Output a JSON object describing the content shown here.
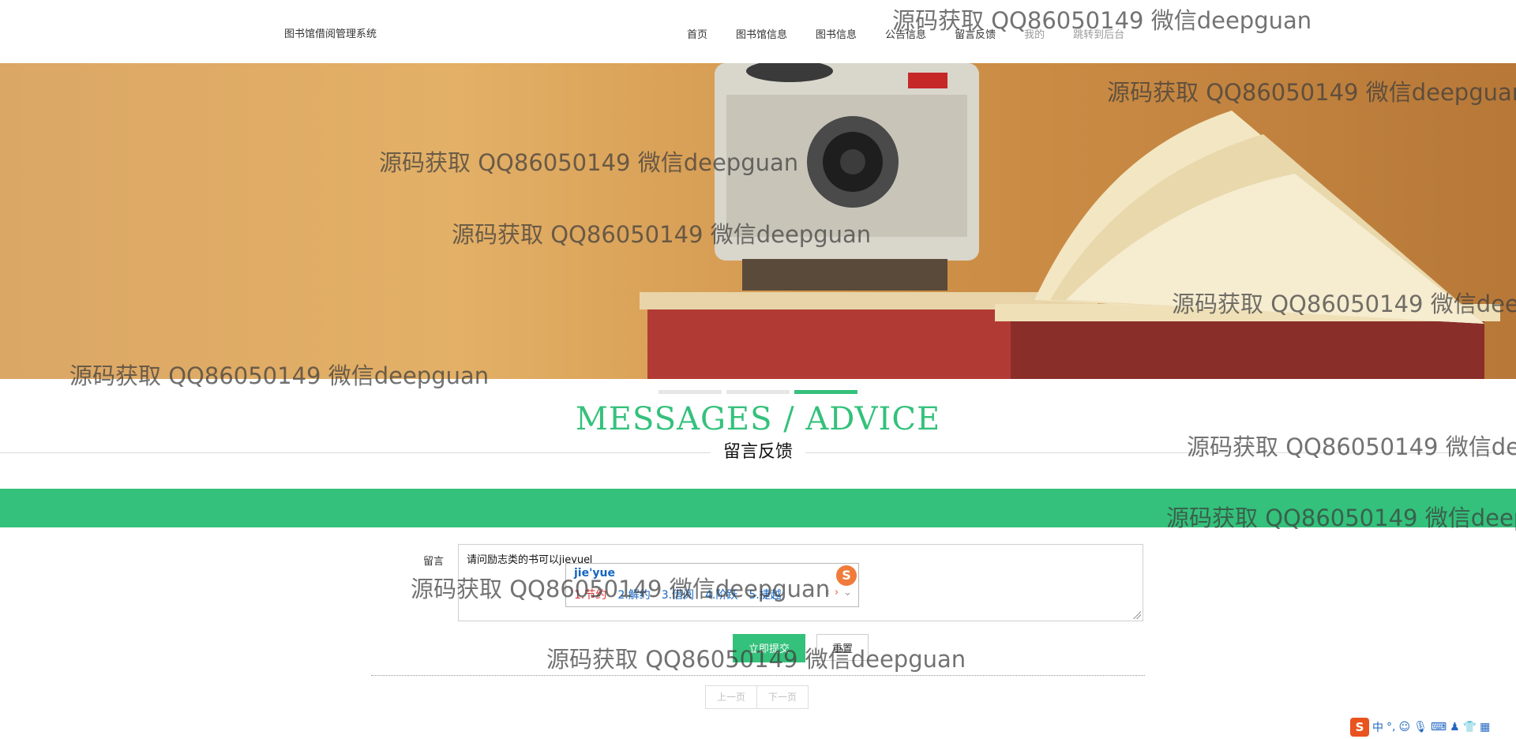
{
  "header": {
    "site_title": "图书馆借阅管理系统",
    "nav": [
      {
        "label": "首页"
      },
      {
        "label": "图书馆信息"
      },
      {
        "label": "图书信息"
      },
      {
        "label": "公告信息"
      },
      {
        "label": "留言反馈"
      },
      {
        "label": "我的"
      },
      {
        "label": "跳转到后台"
      }
    ]
  },
  "section": {
    "title_en": "MESSAGES / ADVICE",
    "title_cn": "留言反馈"
  },
  "form": {
    "message_label": "留言",
    "message_value": "请问励志类的书可以jieyue",
    "submit_label": "立即提交",
    "reset_label": "重置"
  },
  "ime": {
    "pinyin": "jie'yue",
    "candidates": [
      "1.节约",
      "2.解约",
      "3.借阅",
      "4.阶跃",
      "5.捷越"
    ],
    "logo": "S",
    "prev_icon": "chevron-left-icon",
    "next_icon": "chevron-right-icon",
    "expand_icon": "chevron-down-icon"
  },
  "pagination": {
    "prev_label": "上一页",
    "next_label": "下一页"
  },
  "tray": {
    "logo": "S",
    "lang": "中",
    "punct": "°,",
    "icons": [
      "emoji-icon",
      "mic-icon",
      "keyboard-icon",
      "user-icon",
      "shirt-icon",
      "grid-icon"
    ]
  },
  "watermark": {
    "text": "源码获取 QQ86050149 微信deepguan"
  },
  "colors": {
    "accent": "#34c17b",
    "banner": "#dba765",
    "ime_highlight": "#d63030",
    "ime_text": "#1565c0"
  }
}
